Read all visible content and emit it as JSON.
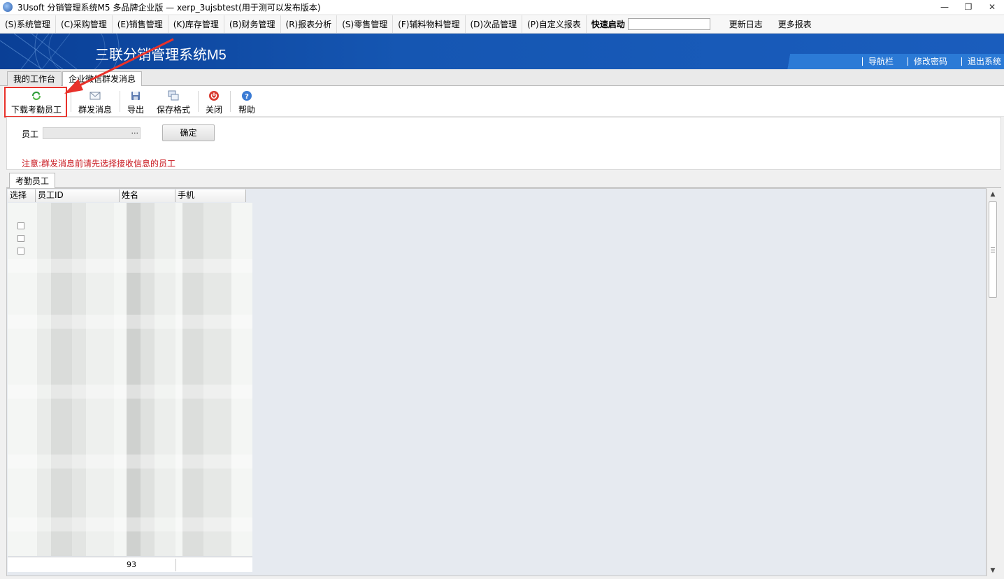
{
  "window": {
    "title": "3Usoft 分销管理系统M5 多品牌企业版 — xerp_3ujsbtest(用于测可以发布版本)",
    "controls": [
      "minimize",
      "restore",
      "close"
    ]
  },
  "menubar": {
    "items": [
      "(S)系统管理",
      "(C)采购管理",
      "(E)销售管理",
      "(K)库存管理",
      "(B)财务管理",
      "(R)报表分析",
      "(S)零售管理",
      "(F)辅料物料管理",
      "(D)次品管理",
      "(P)自定义报表"
    ],
    "quick_label": "快速启动",
    "quick_value": "",
    "links": [
      "更新日志",
      "更多报表"
    ]
  },
  "banner": {
    "title": "三联分销管理系统M5",
    "links": [
      "导航栏",
      "修改密码",
      "退出系统"
    ]
  },
  "tabs": [
    {
      "label": "我的工作台",
      "active": false
    },
    {
      "label": "企业微信群发消息",
      "active": true
    }
  ],
  "toolbar": {
    "buttons": [
      {
        "label": "下载考勤员工",
        "icon": "refresh-icon"
      },
      {
        "label": "群发消息",
        "icon": "mail-icon"
      },
      {
        "label": "导出",
        "icon": "save-icon"
      },
      {
        "label": "保存格式",
        "icon": "layout-icon"
      },
      {
        "label": "关闭",
        "icon": "power-icon"
      },
      {
        "label": "帮助",
        "icon": "help-icon"
      }
    ]
  },
  "filter": {
    "employee_label": "员工",
    "employee_value": "",
    "ellipsis": "···",
    "confirm_label": "确定",
    "note": "注意:群发消息前请先选择接收信息的员工"
  },
  "subtab": {
    "label": "考勤员工"
  },
  "grid": {
    "columns": [
      "选择",
      "员工ID",
      "姓名",
      "手机"
    ],
    "footer_count": "93"
  },
  "colors": {
    "banner": "#1556b2",
    "note": "#c8161d",
    "highlight": "#e8312a"
  }
}
